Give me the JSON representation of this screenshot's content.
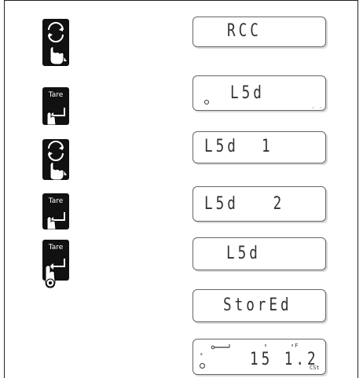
{
  "keys": {
    "tare_label": "Tare"
  },
  "displays": [
    {
      "text": "RCC"
    },
    {
      "text": "L5d"
    },
    {
      "text": "L5d  1"
    },
    {
      "text": "L5d   2"
    },
    {
      "text": "L5d"
    },
    {
      "text": "StorEd"
    },
    {
      "text": "15 1.2",
      "unit": "CSt",
      "mark": "*",
      "small_label": "F"
    }
  ]
}
